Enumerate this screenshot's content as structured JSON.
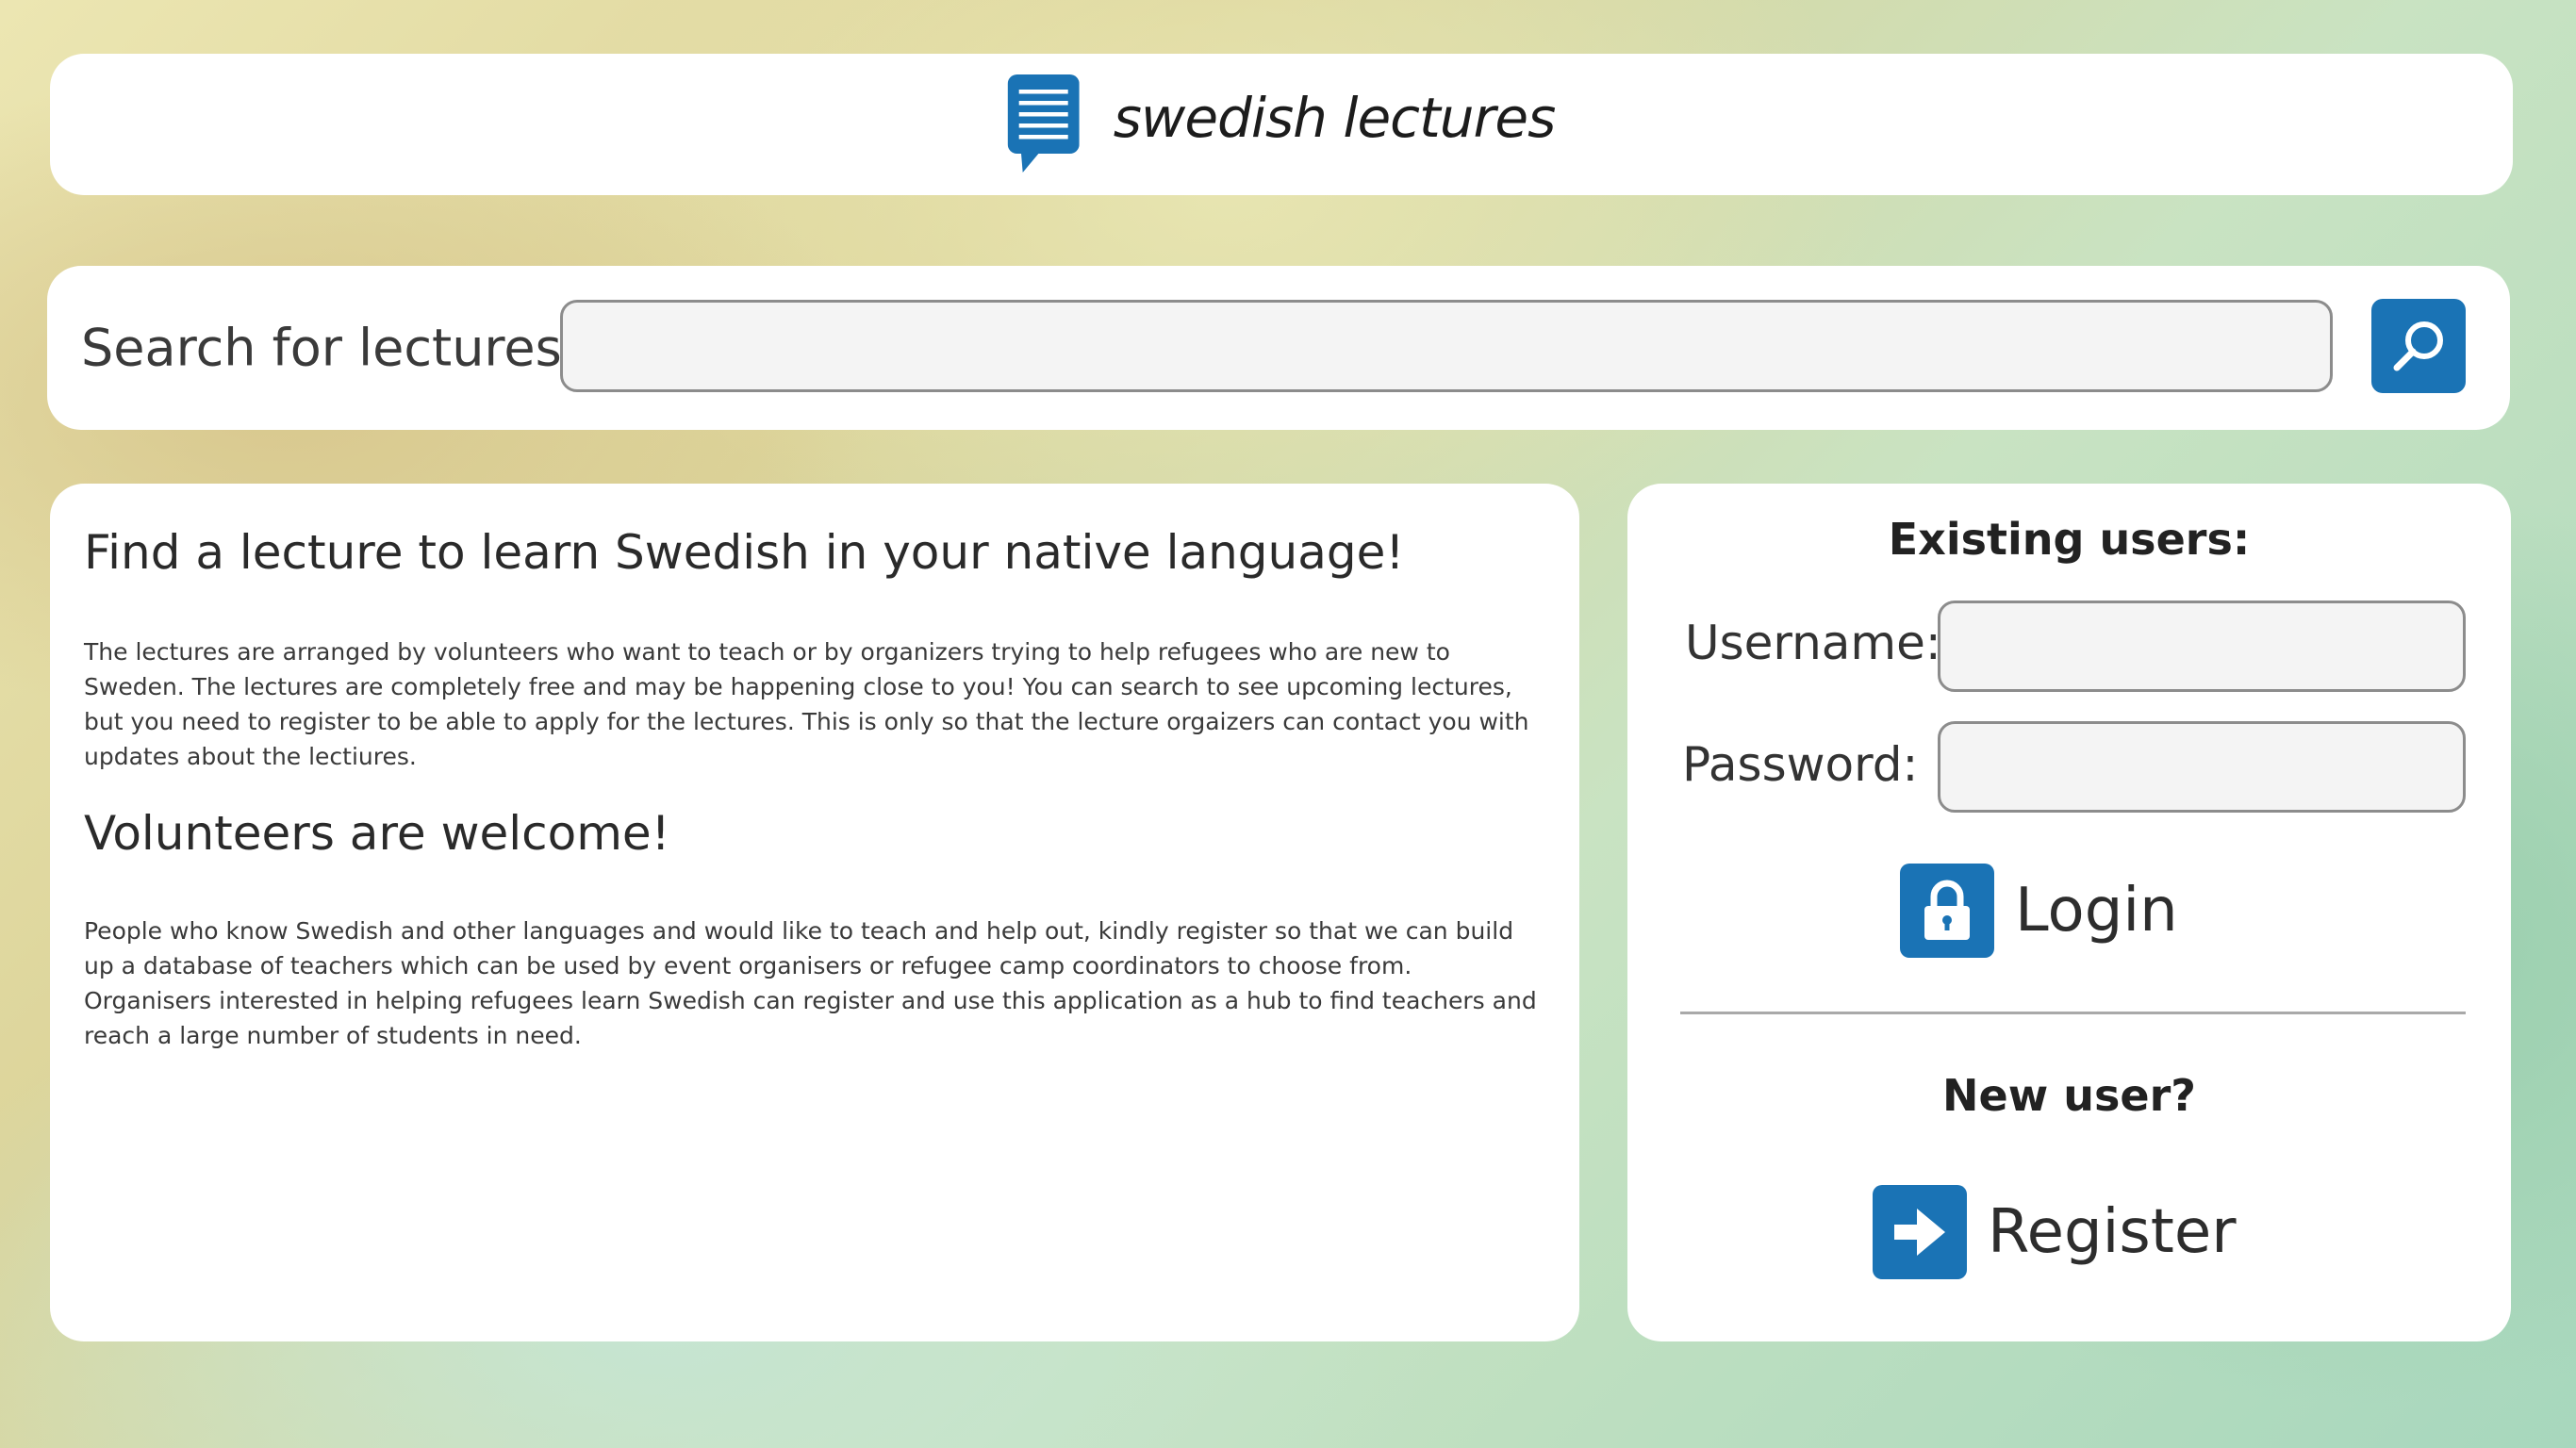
{
  "header": {
    "brand_name": "swedish lectures",
    "logo_icon": "speech-bubble-list-icon"
  },
  "search": {
    "label": "Search for lectures:",
    "value": "",
    "placeholder": "",
    "button_icon": "search-icon"
  },
  "info": {
    "heading": "Find a lecture to learn Swedish in your native language!",
    "paragraph": "The lectures are arranged by volunteers who want to teach or by organizers trying to help refugees who are new to Sweden. The lectures are completely free and may be happening close to you! You can search to see upcoming lectures, but you need to register to be able to apply for the lectures. This is only so that the lecture orgaizers can contact you with updates about the lectiures.",
    "volunteers_heading": "Volunteers are welcome!",
    "volunteers_paragraph": "People who know Swedish and other languages and would like to teach and help out, kindly register so that we can build up a database of teachers which can be used by event organisers or refugee camp coordinators to choose from. Organisers interested in helping refugees learn Swedish can register and use this application as a hub to find teachers and reach a large number of students in need."
  },
  "login": {
    "existing_title": "Existing users:",
    "username_label": "Username:",
    "username_value": "",
    "password_label": "Password:",
    "password_value": "",
    "login_label": "Login",
    "login_icon": "padlock-icon",
    "new_title": "New user?",
    "register_label": "Register",
    "register_icon": "arrow-right-icon"
  },
  "colors": {
    "accent": "#1a73b5",
    "card": "#ffffff",
    "input_bg": "#f4f4f4",
    "input_border": "#8c8c8c"
  }
}
